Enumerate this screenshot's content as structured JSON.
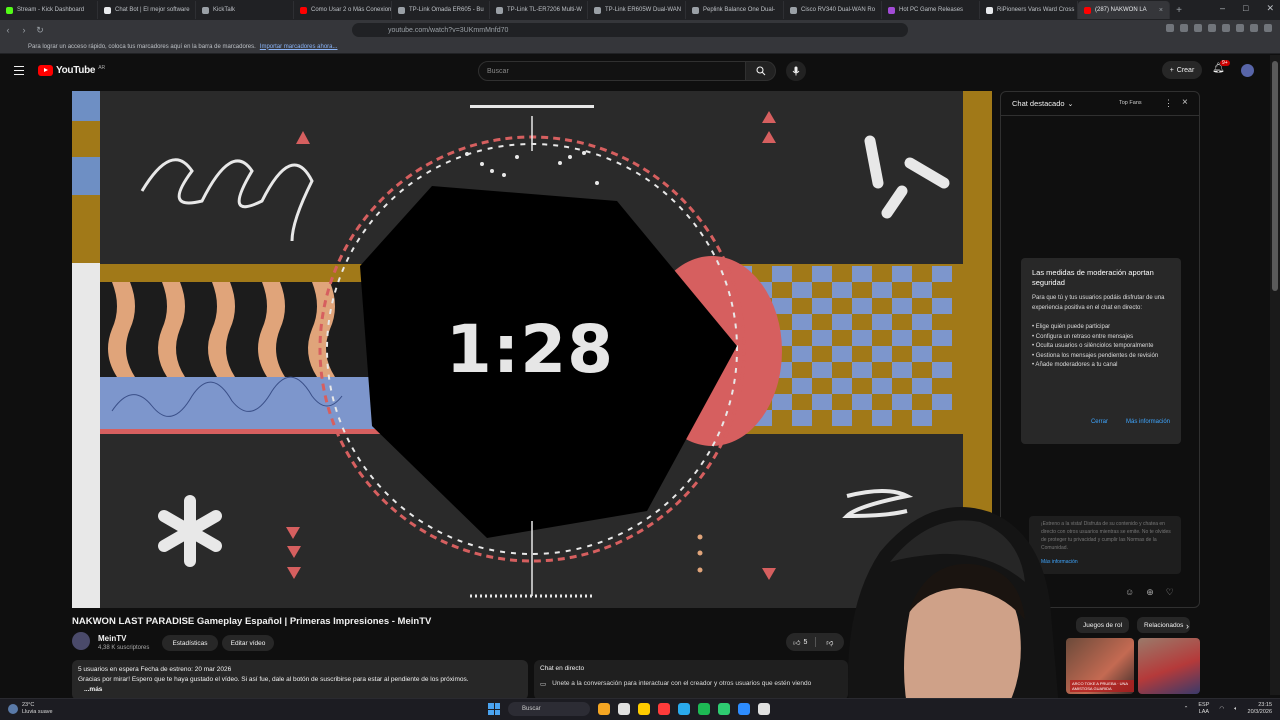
{
  "browser": {
    "tabs": [
      {
        "title": "Stream - Kick Dashboard",
        "color": "#53fc18"
      },
      {
        "title": "Chat Bot | El mejor software",
        "color": "#e8eaed"
      },
      {
        "title": "KickTalk",
        "color": "#9aa0a6"
      },
      {
        "title": "Como Usar 2 o Más Conexiones",
        "color": "#ff0000"
      },
      {
        "title": "TP-Link Omada ER605 - Bu",
        "color": "#9aa0a6"
      },
      {
        "title": "TP-Link TL-ER7206 Multi-W",
        "color": "#9aa0a6"
      },
      {
        "title": "TP-Link ER605W Dual-WAN",
        "color": "#9aa0a6"
      },
      {
        "title": "Peplink Balance One Dual-",
        "color": "#9aa0a6"
      },
      {
        "title": "Cisco RV340 Dual-WAN Ro",
        "color": "#9aa0a6"
      },
      {
        "title": "Hot PC Game Releases",
        "color": "#a24bd6"
      },
      {
        "title": "RiPioneers Vans Ward Cross",
        "color": "#e8eaed"
      }
    ],
    "active_tab": {
      "title": "(287) NAKWON LA",
      "close": "×"
    },
    "new_tab": "+",
    "window_controls": {
      "minimize": "–",
      "maximize": "□",
      "close": "✕"
    },
    "nav": {
      "back": "‹",
      "forward": "›",
      "reload": "↻"
    },
    "url": "youtube.com/watch?v=3UKmmMnfd70",
    "bookmark_bar": {
      "text": "Para lograr un acceso rápido, coloca tus marcadores aquí en la barra de marcadores.",
      "link": "Importar marcadores ahora..."
    }
  },
  "youtube": {
    "logo": "YouTube",
    "country_code": "AR",
    "search_placeholder": "Buscar",
    "create_label": "Crear",
    "notification_count": "9+",
    "icons": {
      "menu": "menu-icon",
      "search": "search-icon",
      "mic": "mic-icon",
      "bell": "bell-icon"
    }
  },
  "video": {
    "timer": "1:28",
    "title": "NAKWON LAST PARADISE Gameplay Español | Primeras Impresiones - MeinTV",
    "channel": "MeinTV",
    "subscribers": "4,38 K suscriptores",
    "stats_button": "Estadísticas",
    "edit_button": "Editar vídeo",
    "likes": "5",
    "description": {
      "meta": "5 usuarios en espera  Fecha de estreno: 20 mar 2026",
      "text": "Gracias por mirar! Espero que te haya gustado el vídeo. Si así fue, dale al botón de suscribirse para estar al pendiente de los próximos.",
      "more": "...más"
    },
    "live_chat_box": {
      "title": "Chat en directo",
      "text": "Únete a la conversación para interactuar con el creador y otros usuarios que estén viendo"
    }
  },
  "chat": {
    "header": "Chat destacado",
    "top_fans": "Top Fans",
    "moderation_card": {
      "title": "Las medidas de moderación aportan seguridad",
      "intro": "Para que tú y tus usuarios podáis disfrutar de una experiencia positiva en el chat en directo:",
      "items": [
        "• Elige quién puede participar",
        "• Configura un retraso entre mensajes",
        "• Oculta usuarios o silénciolos temporalmente",
        "• Gestiona los mensajes pendientes de revisión",
        "• Añade moderadores a tu canal"
      ],
      "cancel": "Cerrar",
      "more_info": "Más información"
    },
    "bottom_note": {
      "text": "¡Estreno a la vista! Disfruta de su contenido y chatea en directo con otros usuarios mientras se emite. No te olvides de proteger tu privacidad y cumplir las Normas de la Comunidad.",
      "link": "Más información"
    }
  },
  "recommendations": {
    "chips": [
      "Juegos de rol",
      "Relacionados"
    ],
    "thumbnail_label": "ARCO TOKE A PRUEBA · UNA AMISTOSA GUARIDA"
  },
  "taskbar": {
    "temperature": "23°C",
    "weather": "Lluvia suave",
    "search": "Buscar",
    "lang_top": "ESP",
    "lang_bottom": "LAA",
    "time": "23:15",
    "date": "20/3/2026",
    "app_colors": [
      "#f5a623",
      "#e0e0e0",
      "#ffcc00",
      "#ff3b3b",
      "#2aabee",
      "#1db954",
      "#2ecc71",
      "#2d8cff",
      "#e0e0e0"
    ]
  }
}
